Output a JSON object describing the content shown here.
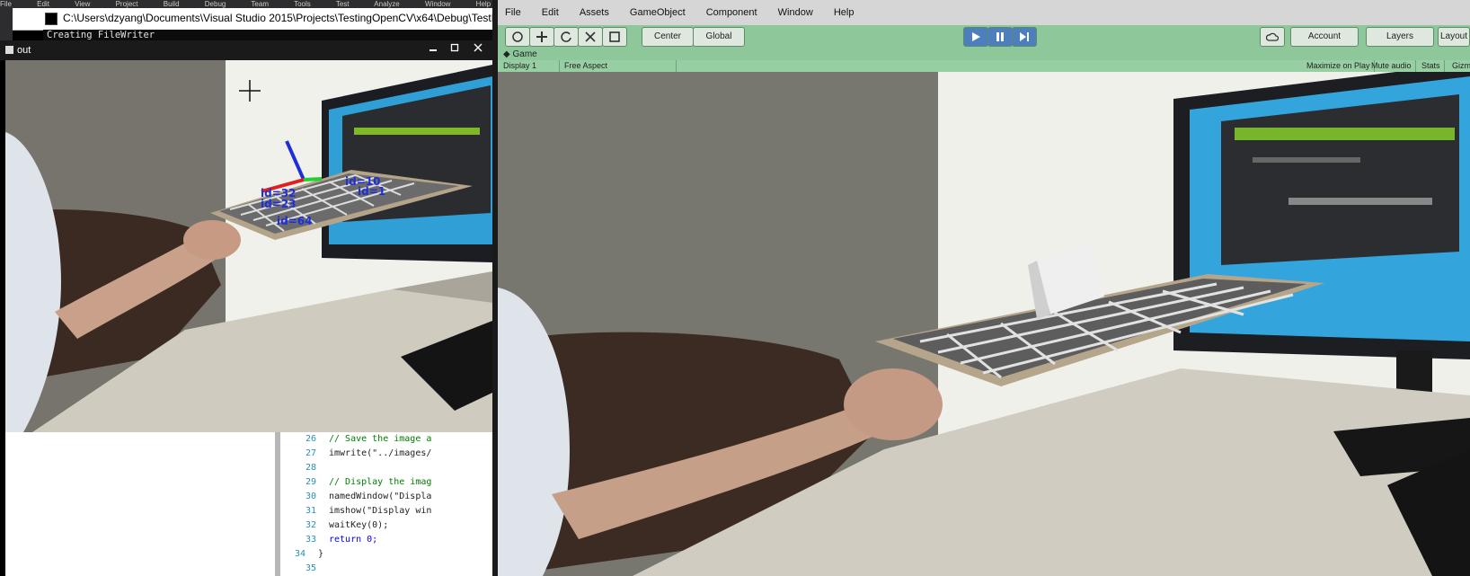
{
  "vs": {
    "menu": [
      "File",
      "Edit",
      "View",
      "Project",
      "Build",
      "Debug",
      "Team",
      "Tools",
      "Test",
      "Analyze",
      "Window",
      "Help"
    ]
  },
  "console": {
    "title": "C:\\Users\\dzyang\\Documents\\Visual Studio 2015\\Projects\\TestingOpenCV\\x64\\Debug\\TestLear",
    "output": "Creating FileWriter"
  },
  "cv_window": {
    "title": "out",
    "min_icon": "minimize-icon",
    "max_icon": "maximize-icon",
    "close_icon": "close-icon",
    "marker_labels": [
      "id=10",
      "id=32",
      "id=1",
      "id=23",
      "id=64"
    ]
  },
  "code": {
    "lines": [
      {
        "n": "26",
        "text": "// Save the image a",
        "kind": "comment"
      },
      {
        "n": "27",
        "text": "imwrite(\"../images/",
        "kind": "code"
      },
      {
        "n": "28",
        "text": "",
        "kind": "code"
      },
      {
        "n": "29",
        "text": "// Display the imag",
        "kind": "comment"
      },
      {
        "n": "30",
        "text": "namedWindow(\"Displa",
        "kind": "code"
      },
      {
        "n": "31",
        "text": "imshow(\"Display win",
        "kind": "code"
      },
      {
        "n": "32",
        "text": "waitKey(0);",
        "kind": "code"
      },
      {
        "n": "33",
        "text": "return 0;",
        "kind": "keyword"
      },
      {
        "n": "34",
        "text": "}",
        "kind": "code"
      },
      {
        "n": "35",
        "text": "",
        "kind": "code"
      }
    ]
  },
  "unity": {
    "menu": [
      "File",
      "Edit",
      "Assets",
      "GameObject",
      "Component",
      "Window",
      "Help"
    ],
    "toolbar": {
      "hand_icon": "hand-tool-icon",
      "move_icon": "move-tool-icon",
      "rotate_icon": "rotate-tool-icon",
      "scale_icon": "scale-tool-icon",
      "rect_icon": "rect-tool-icon",
      "center_label": "Center",
      "global_label": "Global",
      "play_icon": "play-icon",
      "pause_icon": "pause-icon",
      "step_icon": "step-icon",
      "cloud_icon": "cloud-icon",
      "account_label": "Account",
      "layers_label": "Layers",
      "layout_label": "Layout"
    },
    "game": {
      "tab_label": "Game",
      "display": "Display 1",
      "aspect": "Free Aspect",
      "maximize": "Maximize on Play",
      "mute": "Mute audio",
      "stats": "Stats",
      "gizmos": "Gizmos"
    }
  },
  "colors": {
    "unity_toolbar": "#8ec89a",
    "play_active": "#4d7fbf",
    "console_bg": "#0c0c0c"
  }
}
